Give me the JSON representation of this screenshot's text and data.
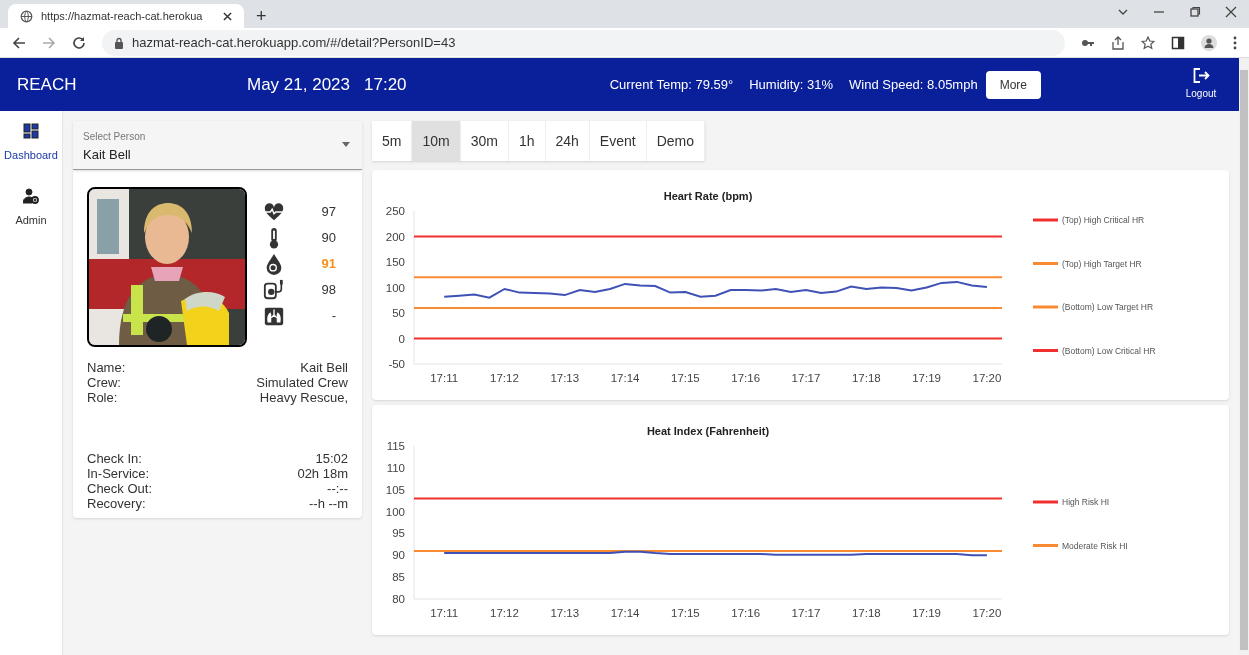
{
  "browser": {
    "tab_title": "https://hazmat-reach-cat.herokua",
    "new_tab": "+",
    "url": "hazmat-reach-cat.herokuapp.com/#/detail?PersonID=43"
  },
  "header": {
    "brand": "REACH",
    "date": "May 21, 2023",
    "time": "17:20",
    "temp": "Current Temp: 79.59°",
    "humidity": "Humidity: 31%",
    "wind": "Wind Speed: 8.05mph",
    "more_button": "More",
    "logout": "Logout"
  },
  "sidebar": {
    "items": [
      {
        "kind": "dashboard",
        "label": "Dashboard",
        "selected": true
      },
      {
        "kind": "admin",
        "label": "Admin",
        "selected": false
      }
    ]
  },
  "person": {
    "select_label": "Select Person",
    "select_value": "Kait Bell",
    "vitals": [
      {
        "kind": "heart",
        "value": "97",
        "alert": false
      },
      {
        "kind": "temperature",
        "value": "90",
        "alert": false
      },
      {
        "kind": "oxygen",
        "value": "91",
        "alert": true
      },
      {
        "kind": "pressure",
        "value": "98",
        "alert": false
      },
      {
        "kind": "lungs",
        "value": "-",
        "alert": false
      }
    ],
    "info": [
      {
        "label": "Name:",
        "value": "Kait Bell"
      },
      {
        "label": "Crew:",
        "value": "Simulated Crew"
      },
      {
        "label": "Role:",
        "value": "Heavy Rescue,"
      }
    ],
    "times": [
      {
        "label": "Check In:",
        "value": "15:02"
      },
      {
        "label": "In-Service:",
        "value": "02h 18m"
      },
      {
        "label": "Check Out:",
        "value": "--:--"
      },
      {
        "label": "Recovery:",
        "value": "--h --m"
      }
    ]
  },
  "time_ranges": [
    {
      "label": "5m",
      "selected": false
    },
    {
      "label": "10m",
      "selected": true
    },
    {
      "label": "30m",
      "selected": false
    },
    {
      "label": "1h",
      "selected": false
    },
    {
      "label": "24h",
      "selected": false
    },
    {
      "label": "Event",
      "selected": false
    },
    {
      "label": "Demo",
      "selected": false
    }
  ],
  "charts": [
    {
      "chart_data": {
        "type": "line",
        "title": "Heart Rate (bpm)",
        "categories": [
          null,
          null,
          "17:11",
          null,
          null,
          null,
          "17:12",
          null,
          null,
          null,
          "17:13",
          null,
          null,
          null,
          "17:14",
          null,
          null,
          null,
          "17:15",
          null,
          null,
          null,
          "17:16",
          null,
          null,
          null,
          "17:17",
          null,
          null,
          null,
          "17:18",
          null,
          null,
          null,
          "17:19",
          null,
          null,
          null,
          "17:20",
          null
        ],
        "series": [
          {
            "color": "#3f51b5",
            "values": [
              null,
              null,
              82,
              84,
              86,
              80,
              97,
              90,
              89,
              88,
              85,
              95,
              91,
              97,
              107,
              104,
              103,
              90,
              91,
              82,
              84,
              95,
              95,
              94,
              97,
              91,
              95,
              89,
              92,
              102,
              97,
              100,
              99,
              94,
              100,
              109,
              111,
              104,
              101,
              null
            ]
          },
          {
            "name": "(Top) High Critical HR",
            "color": "#f0302e",
            "values": [
              200,
              200,
              200,
              200,
              200,
              200,
              200,
              200,
              200,
              200,
              200,
              200,
              200,
              200,
              200,
              200,
              200,
              200,
              200,
              200,
              200,
              200,
              200,
              200,
              200,
              200,
              200,
              200,
              200,
              200,
              200,
              200,
              200,
              200,
              200,
              200,
              200,
              200,
              200,
              200
            ]
          },
          {
            "name": "(Top) High Target HR",
            "color": "#f88a34",
            "values": [
              120,
              120,
              120,
              120,
              120,
              120,
              120,
              120,
              120,
              120,
              120,
              120,
              120,
              120,
              120,
              120,
              120,
              120,
              120,
              120,
              120,
              120,
              120,
              120,
              120,
              120,
              120,
              120,
              120,
              120,
              120,
              120,
              120,
              120,
              120,
              120,
              120,
              120,
              120,
              120
            ]
          },
          {
            "name": "(Bottom) Low Target HR",
            "color": "#f88a34",
            "values": [
              60,
              60,
              60,
              60,
              60,
              60,
              60,
              60,
              60,
              60,
              60,
              60,
              60,
              60,
              60,
              60,
              60,
              60,
              60,
              60,
              60,
              60,
              60,
              60,
              60,
              60,
              60,
              60,
              60,
              60,
              60,
              60,
              60,
              60,
              60,
              60,
              60,
              60,
              60,
              60
            ]
          },
          {
            "name": "(Bottom) Low Critical HR",
            "color": "#f0302e",
            "values": [
              0,
              0,
              0,
              0,
              0,
              0,
              0,
              0,
              0,
              0,
              0,
              0,
              0,
              0,
              0,
              0,
              0,
              0,
              0,
              0,
              0,
              0,
              0,
              0,
              0,
              0,
              0,
              0,
              0,
              0,
              0,
              0,
              0,
              0,
              0,
              0,
              0,
              0,
              0,
              0
            ]
          }
        ],
        "ylim": [
          -50,
          250
        ],
        "yticks": [
          -50,
          0,
          50,
          100,
          150,
          200,
          250
        ],
        "legend": "right"
      }
    },
    {
      "chart_data": {
        "type": "line",
        "title": "Heat Index (Fahrenheit)",
        "categories": [
          null,
          null,
          "17:11",
          null,
          null,
          null,
          "17:12",
          null,
          null,
          null,
          "17:13",
          null,
          null,
          null,
          "17:14",
          null,
          null,
          null,
          "17:15",
          null,
          null,
          null,
          "17:16",
          null,
          null,
          null,
          "17:17",
          null,
          null,
          null,
          "17:18",
          null,
          null,
          null,
          "17:19",
          null,
          null,
          null,
          "17:20",
          null
        ],
        "series": [
          {
            "color": "#3f51b5",
            "values": [
              null,
              null,
              90.5,
              90.5,
              90.5,
              90.5,
              90.5,
              90.5,
              90.5,
              90.5,
              90.5,
              90.5,
              90.5,
              90.5,
              90.8,
              90.8,
              90.5,
              90.3,
              90.3,
              90.3,
              90.3,
              90.3,
              90.3,
              90.3,
              90.1,
              90.1,
              90.1,
              90.1,
              90.1,
              90.1,
              90.3,
              90.3,
              90.3,
              90.3,
              90.3,
              90.3,
              90.3,
              90,
              90,
              null
            ]
          },
          {
            "name": "High Risk HI",
            "color": "#f0302e",
            "values": [
              103,
              103,
              103,
              103,
              103,
              103,
              103,
              103,
              103,
              103,
              103,
              103,
              103,
              103,
              103,
              103,
              103,
              103,
              103,
              103,
              103,
              103,
              103,
              103,
              103,
              103,
              103,
              103,
              103,
              103,
              103,
              103,
              103,
              103,
              103,
              103,
              103,
              103,
              103,
              103
            ]
          },
          {
            "name": "Moderate Risk HI",
            "color": "#f88a34",
            "values": [
              91,
              91,
              91,
              91,
              91,
              91,
              91,
              91,
              91,
              91,
              91,
              91,
              91,
              91,
              91,
              91,
              91,
              91,
              91,
              91,
              91,
              91,
              91,
              91,
              91,
              91,
              91,
              91,
              91,
              91,
              91,
              91,
              91,
              91,
              91,
              91,
              91,
              91,
              91,
              91
            ]
          }
        ],
        "ylim": [
          80,
          115
        ],
        "yticks": [
          80,
          85,
          90,
          95,
          100,
          105,
          110,
          115
        ],
        "legend": "right"
      }
    }
  ]
}
